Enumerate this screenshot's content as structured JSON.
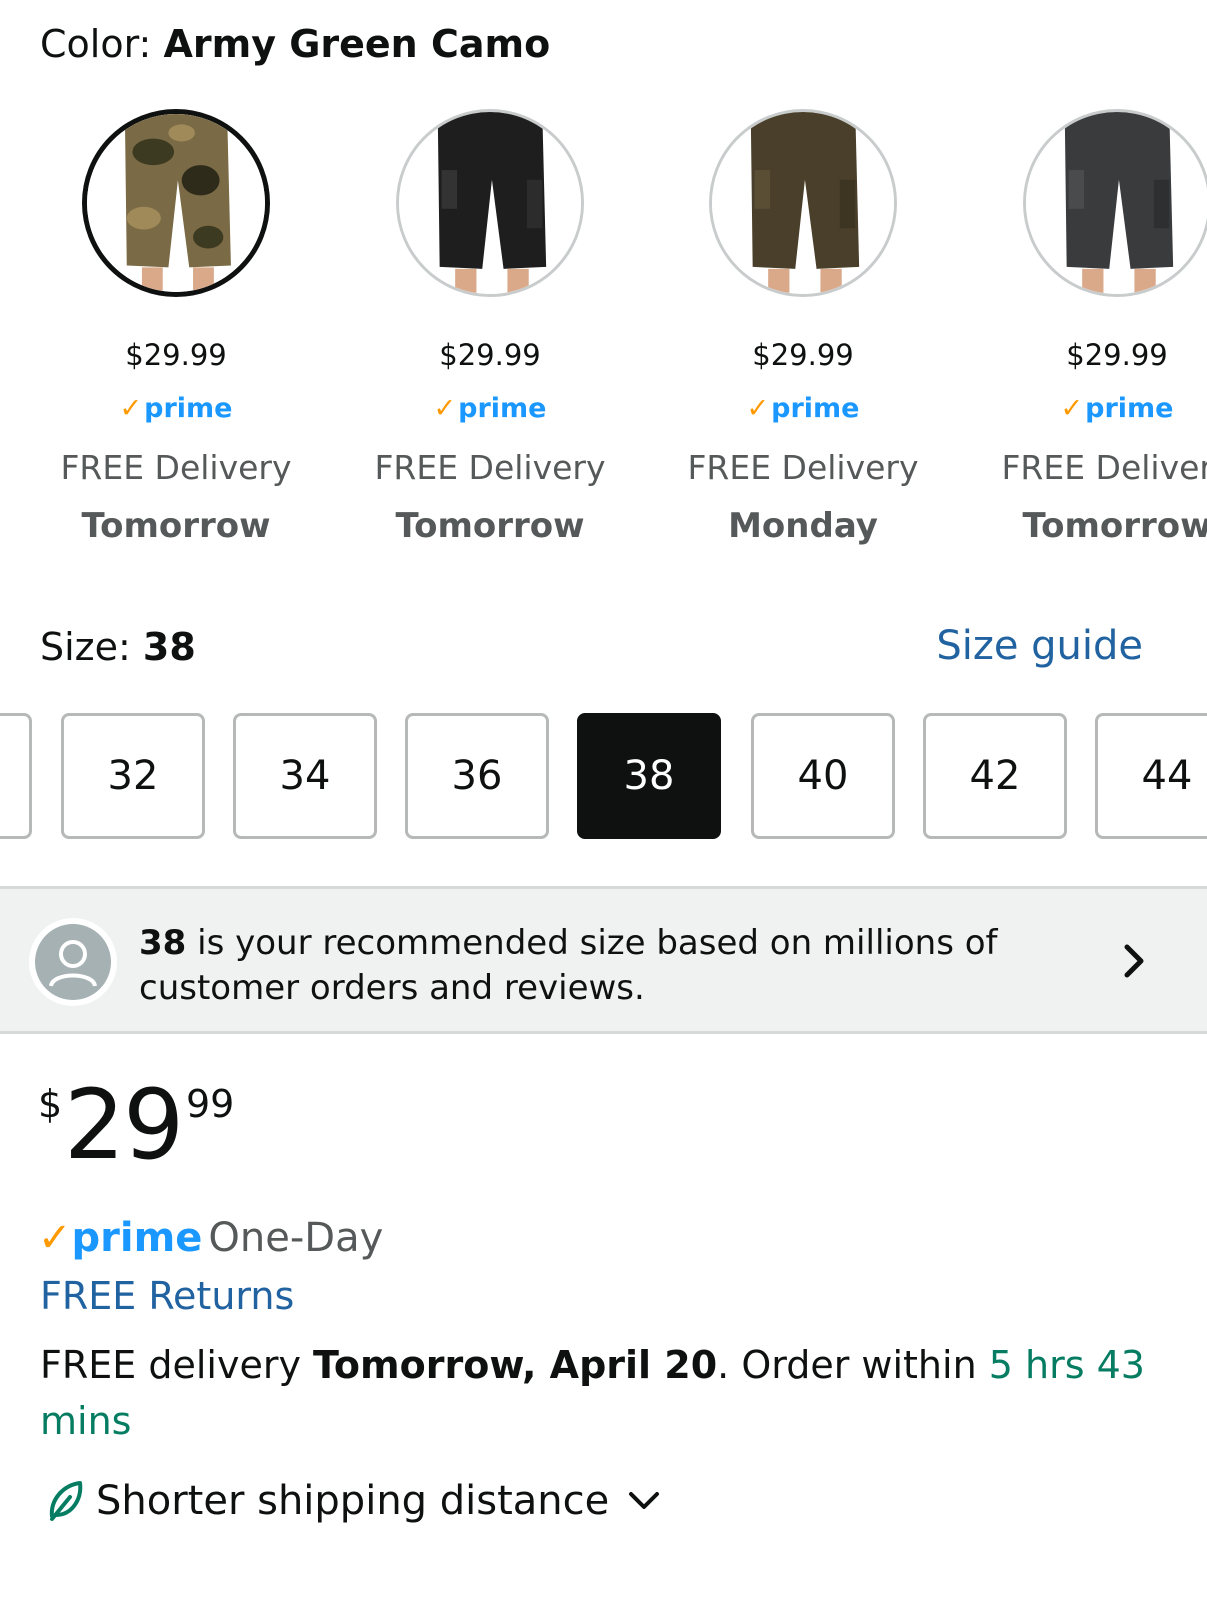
{
  "color": {
    "label": "Color:",
    "value": "Army Green Camo"
  },
  "swatches": [
    {
      "price": "$29.99",
      "prime": "prime",
      "delivery": "FREE Delivery",
      "day": "Tomorrow",
      "color": "#6b5a3a"
    },
    {
      "price": "$29.99",
      "prime": "prime",
      "delivery": "FREE Delivery",
      "day": "Tomorrow",
      "color": "#1e1e1e"
    },
    {
      "price": "$29.99",
      "prime": "prime",
      "delivery": "FREE Delivery",
      "day": "Monday",
      "color": "#4a3f2a"
    },
    {
      "price": "$29.99",
      "prime": "prime",
      "delivery": "FREE Delivery",
      "day": "Tomorrow",
      "color": "#3a3b3d"
    }
  ],
  "size": {
    "label": "Size:",
    "value": "38",
    "guide": "Size guide"
  },
  "sizes": [
    "32",
    "34",
    "36",
    "38",
    "40",
    "42",
    "44"
  ],
  "recommendation": {
    "size": "38",
    "text": " is your recommended size based on millions of customer orders and reviews."
  },
  "price": {
    "currency": "$",
    "whole": "29",
    "fraction": "99"
  },
  "prime_line": {
    "brand": "prime",
    "service": "One-Day"
  },
  "free_returns": "FREE Returns",
  "delivery": {
    "prefix": "FREE delivery ",
    "date": "Tomorrow, April 20",
    "middle": ". Order within ",
    "countdown": "5 hrs 43 mins"
  },
  "shipping": {
    "label": "Shorter shipping distance"
  },
  "colors": {
    "link": "#2162a1",
    "prime_blue": "#1a98ff",
    "prime_check": "#ff9900",
    "countdown": "#067d62"
  }
}
